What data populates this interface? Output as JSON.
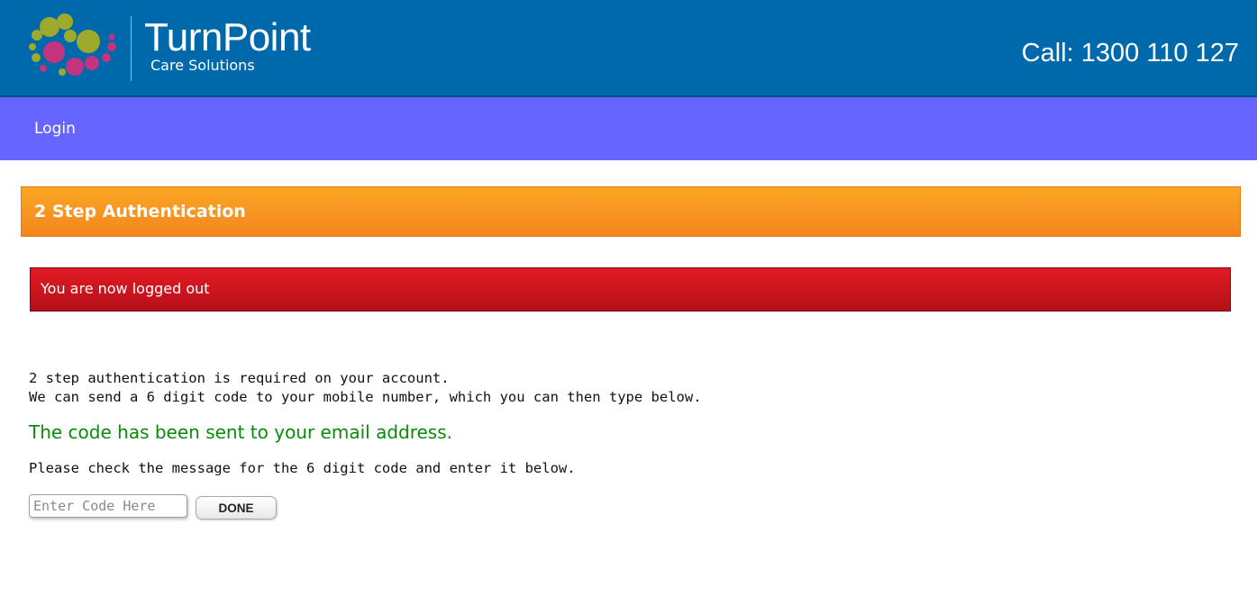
{
  "header": {
    "brand_main": "Turn",
    "brand_accent": "Point",
    "brand_sub": "Care Solutions",
    "logo_icon": "dot-cluster-logo",
    "phone": "Call: 1300 110 127",
    "background_color": "#0069ab"
  },
  "nav": {
    "login_label": "Login",
    "background_color": "#6666ff"
  },
  "panel": {
    "title": "2 Step Authentication",
    "title_color": "#f5851f"
  },
  "alert": {
    "message": "You are now logged out",
    "color": "#d6151f"
  },
  "info": {
    "line1": "2 step authentication is required on your account.",
    "line2": "We can send a 6 digit code to your mobile number, which you can then type below."
  },
  "success": {
    "message": "The code has been sent to your email address.",
    "color": "#0a8a0a"
  },
  "instruction": "Please check the message for the 6 digit code and enter it below.",
  "form": {
    "code_value": "",
    "code_placeholder": "Enter Code Here",
    "done_label": "DONE"
  }
}
